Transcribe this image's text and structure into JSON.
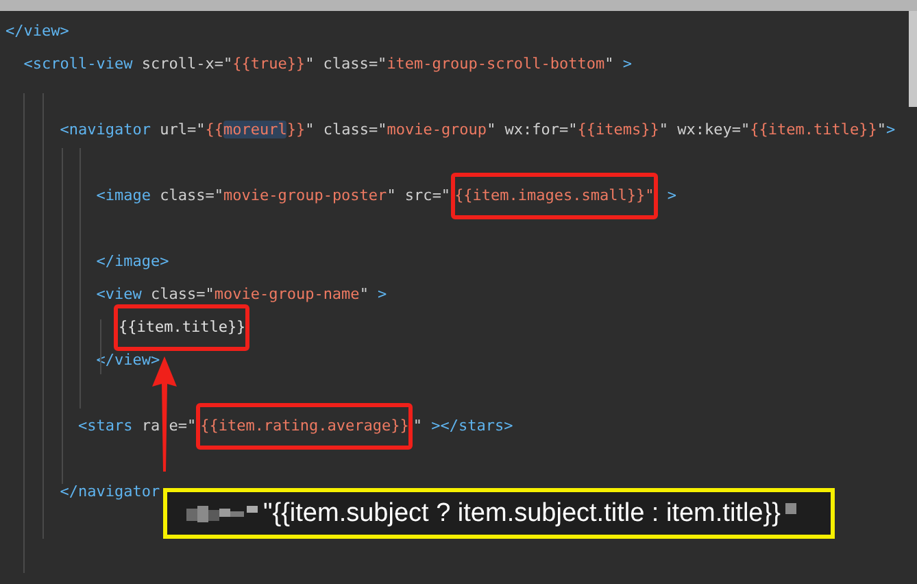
{
  "editor": {
    "lines": [
      {
        "gap": false,
        "tokens": [
          {
            "kind": "tag",
            "text": "</view>"
          }
        ]
      },
      {
        "gap": false,
        "tokens": [
          {
            "kind": "tag",
            "text": "  <scroll-view"
          },
          {
            "kind": "attr",
            "text": " scroll-x"
          },
          {
            "kind": "punct",
            "text": "=\""
          },
          {
            "kind": "str",
            "text": "{{true}}"
          },
          {
            "kind": "punct",
            "text": "\""
          },
          {
            "kind": "attr",
            "text": " class"
          },
          {
            "kind": "punct",
            "text": "=\""
          },
          {
            "kind": "str",
            "text": "item-group-scroll-bottom"
          },
          {
            "kind": "punct",
            "text": "\""
          },
          {
            "kind": "tag",
            "text": " >"
          }
        ]
      },
      {
        "gap": true,
        "tokens": [
          {
            "kind": "tag",
            "text": "      <navigator"
          },
          {
            "kind": "attr",
            "text": " url"
          },
          {
            "kind": "punct",
            "text": "=\""
          },
          {
            "kind": "str",
            "text": "{{"
          },
          {
            "kind": "str",
            "text": "moreurl",
            "selected": true
          },
          {
            "kind": "str",
            "text": "}}"
          },
          {
            "kind": "punct",
            "text": "\""
          },
          {
            "kind": "attr",
            "text": " class"
          },
          {
            "kind": "punct",
            "text": "=\""
          },
          {
            "kind": "str",
            "text": "movie-group"
          },
          {
            "kind": "punct",
            "text": "\""
          },
          {
            "kind": "attr",
            "text": " wx:for"
          },
          {
            "kind": "punct",
            "text": "=\""
          },
          {
            "kind": "str",
            "text": "{{items}}"
          },
          {
            "kind": "punct",
            "text": "\""
          },
          {
            "kind": "attr",
            "text": " wx:key"
          },
          {
            "kind": "punct",
            "text": "=\""
          },
          {
            "kind": "str",
            "text": "{{item.title}}"
          },
          {
            "kind": "punct",
            "text": "\""
          },
          {
            "kind": "tag",
            "text": ">"
          }
        ]
      },
      {
        "gap": true,
        "tokens": [
          {
            "kind": "tag",
            "text": "          <image"
          },
          {
            "kind": "attr",
            "text": " class"
          },
          {
            "kind": "punct",
            "text": "=\""
          },
          {
            "kind": "str",
            "text": "movie-group-poster"
          },
          {
            "kind": "punct",
            "text": "\""
          },
          {
            "kind": "attr",
            "text": " src"
          },
          {
            "kind": "punct",
            "text": "=\""
          },
          {
            "kind": "str",
            "text": "{{item.images.small}}\"",
            "boxed": true
          },
          {
            "kind": "tag",
            "text": " >"
          }
        ]
      },
      {
        "gap": true,
        "tokens": [
          {
            "kind": "tag",
            "text": "          </image>"
          }
        ]
      },
      {
        "gap": false,
        "tokens": [
          {
            "kind": "tag",
            "text": "          <view"
          },
          {
            "kind": "attr",
            "text": " class"
          },
          {
            "kind": "punct",
            "text": "=\""
          },
          {
            "kind": "str",
            "text": "movie-group-name"
          },
          {
            "kind": "punct",
            "text": "\""
          },
          {
            "kind": "tag",
            "text": " >"
          }
        ]
      },
      {
        "gap": false,
        "kind": "content",
        "tokens": [
          {
            "kind": "brace",
            "text": "{{item.title}}",
            "boxed": true
          }
        ]
      },
      {
        "gap": false,
        "tokens": [
          {
            "kind": "tag",
            "text": "          </view>"
          }
        ]
      },
      {
        "gap": true,
        "tokens": [
          {
            "kind": "tag",
            "text": "        <stars"
          },
          {
            "kind": "attr",
            "text": " ra",
            "covered": true
          },
          {
            "kind": "attr",
            "text": "e"
          },
          {
            "kind": "punct",
            "text": "=\""
          },
          {
            "kind": "str",
            "text": "{{item.rating.average}}",
            "boxed": true
          },
          {
            "kind": "punct",
            "text": "\""
          },
          {
            "kind": "tag",
            "text": " ></stars>"
          }
        ]
      },
      {
        "gap": true,
        "tokens": [
          {
            "kind": "tag",
            "text": "      </navigator"
          }
        ]
      }
    ]
  },
  "callout": {
    "text": "\"{{item.subject ? item.subject.title : item.title}}"
  }
}
